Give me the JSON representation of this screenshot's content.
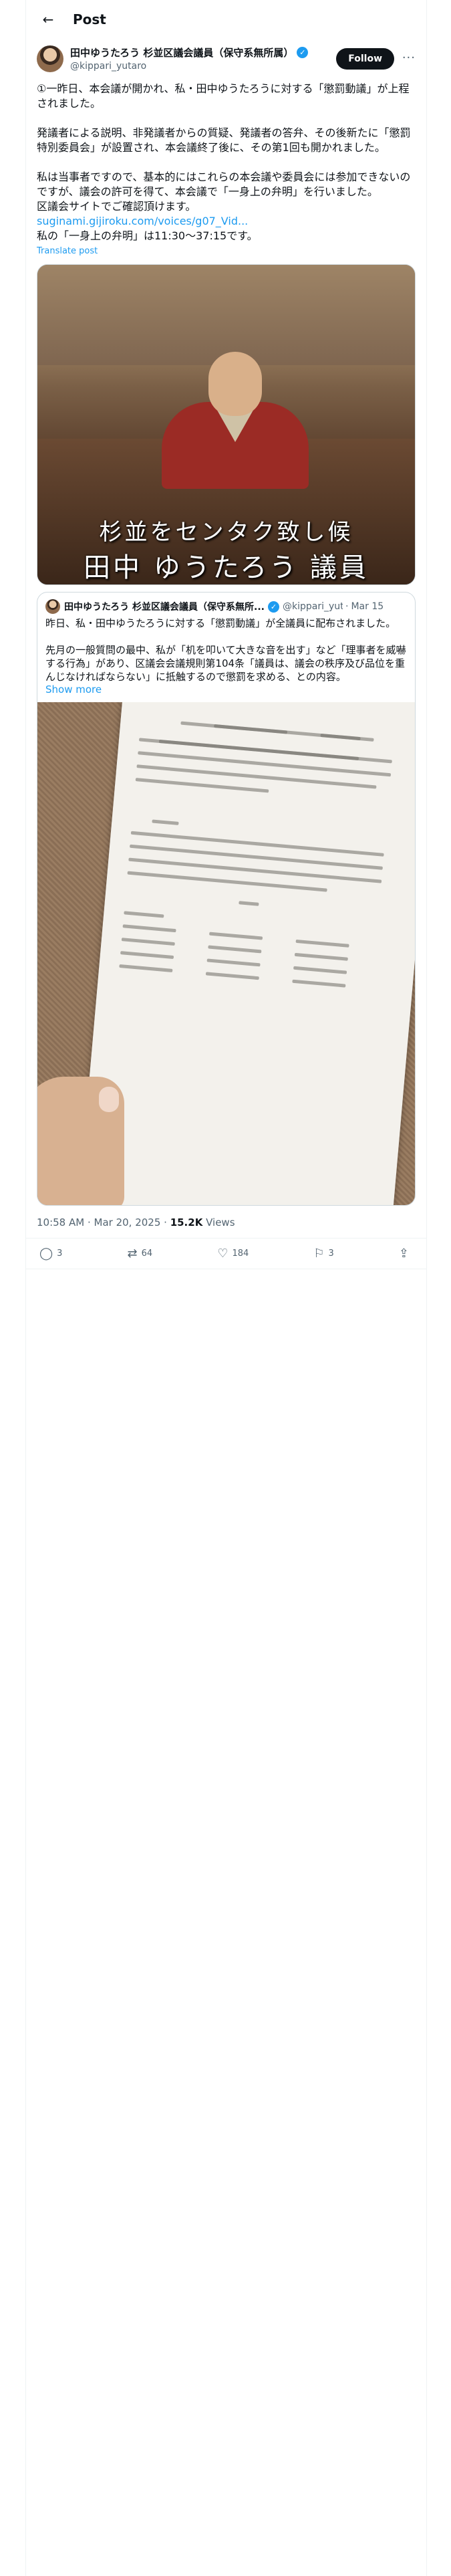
{
  "topbar": {
    "back_icon": "arrow-left-icon",
    "title": "Post"
  },
  "author": {
    "name": "田中ゆうたろう 杉並区議会議員（保守系無所属）",
    "handle": "@kippari_yutaro",
    "verified_icon": "verified-badge-icon",
    "follow_label": "Follow",
    "more_label": "···"
  },
  "tweet": {
    "text_main": "①一昨日、本会議が開かれ、私・田中ゆうたろうに対する「懲罰動議」が上程されました。\n\n発議者による説明、非発議者からの質疑、発議者の答弁、その後新たに「懲罰特別委員会」が設置され、本会議終了後に、その第1回も開かれました。\n\n私は当事者ですので、基本的にはこれらの本会議や委員会には参加できないのですが、議会の許可を得て、本会議で「一身上の弁明」を行いました。\n区議会サイトでご確認頂けます。",
    "link": "suginami.gijiroku.com/voices/g07_Vid...",
    "text_tail": "私の「一身上の弁明」は11:30〜37:15です。",
    "translate": "Translate post"
  },
  "video": {
    "caption_line1": "杉並をセンタク致し候",
    "caption_line2": "田中 ゆうたろう 議員"
  },
  "quote": {
    "name": "田中ゆうたろう 杉並区議会議員（保守系無所...",
    "handle": "@kippari_yut...",
    "dot": "·",
    "date": "Mar 15",
    "text": "昨日、私・田中ゆうたろうに対する「懲罰動議」が全議員に配布されました。\n\n先月の一般質問の最中、私が「机を叩いて大きな音を出す」など「理事者を威嚇する行為」があり、区議会会議規則第104条「議員は、議会の秩序及び品位を重んじなければならない」に抵触するので懲罰を求める、との内容。",
    "show_more": "Show more"
  },
  "meta": {
    "time": "10:58 AM · Mar 20, 2025 · ",
    "views_count": "15.2K",
    "views_label": " Views"
  },
  "actions": {
    "reply": {
      "icon": "reply-icon",
      "count": "3"
    },
    "repost": {
      "icon": "repost-icon",
      "count": "64"
    },
    "like": {
      "icon": "heart-icon",
      "count": "184"
    },
    "bookmark": {
      "icon": "bookmark-icon",
      "count": "3"
    },
    "share": {
      "icon": "share-icon"
    }
  },
  "colors": {
    "accent": "#1d9bf0",
    "text": "#0f1419",
    "muted": "#536471"
  }
}
